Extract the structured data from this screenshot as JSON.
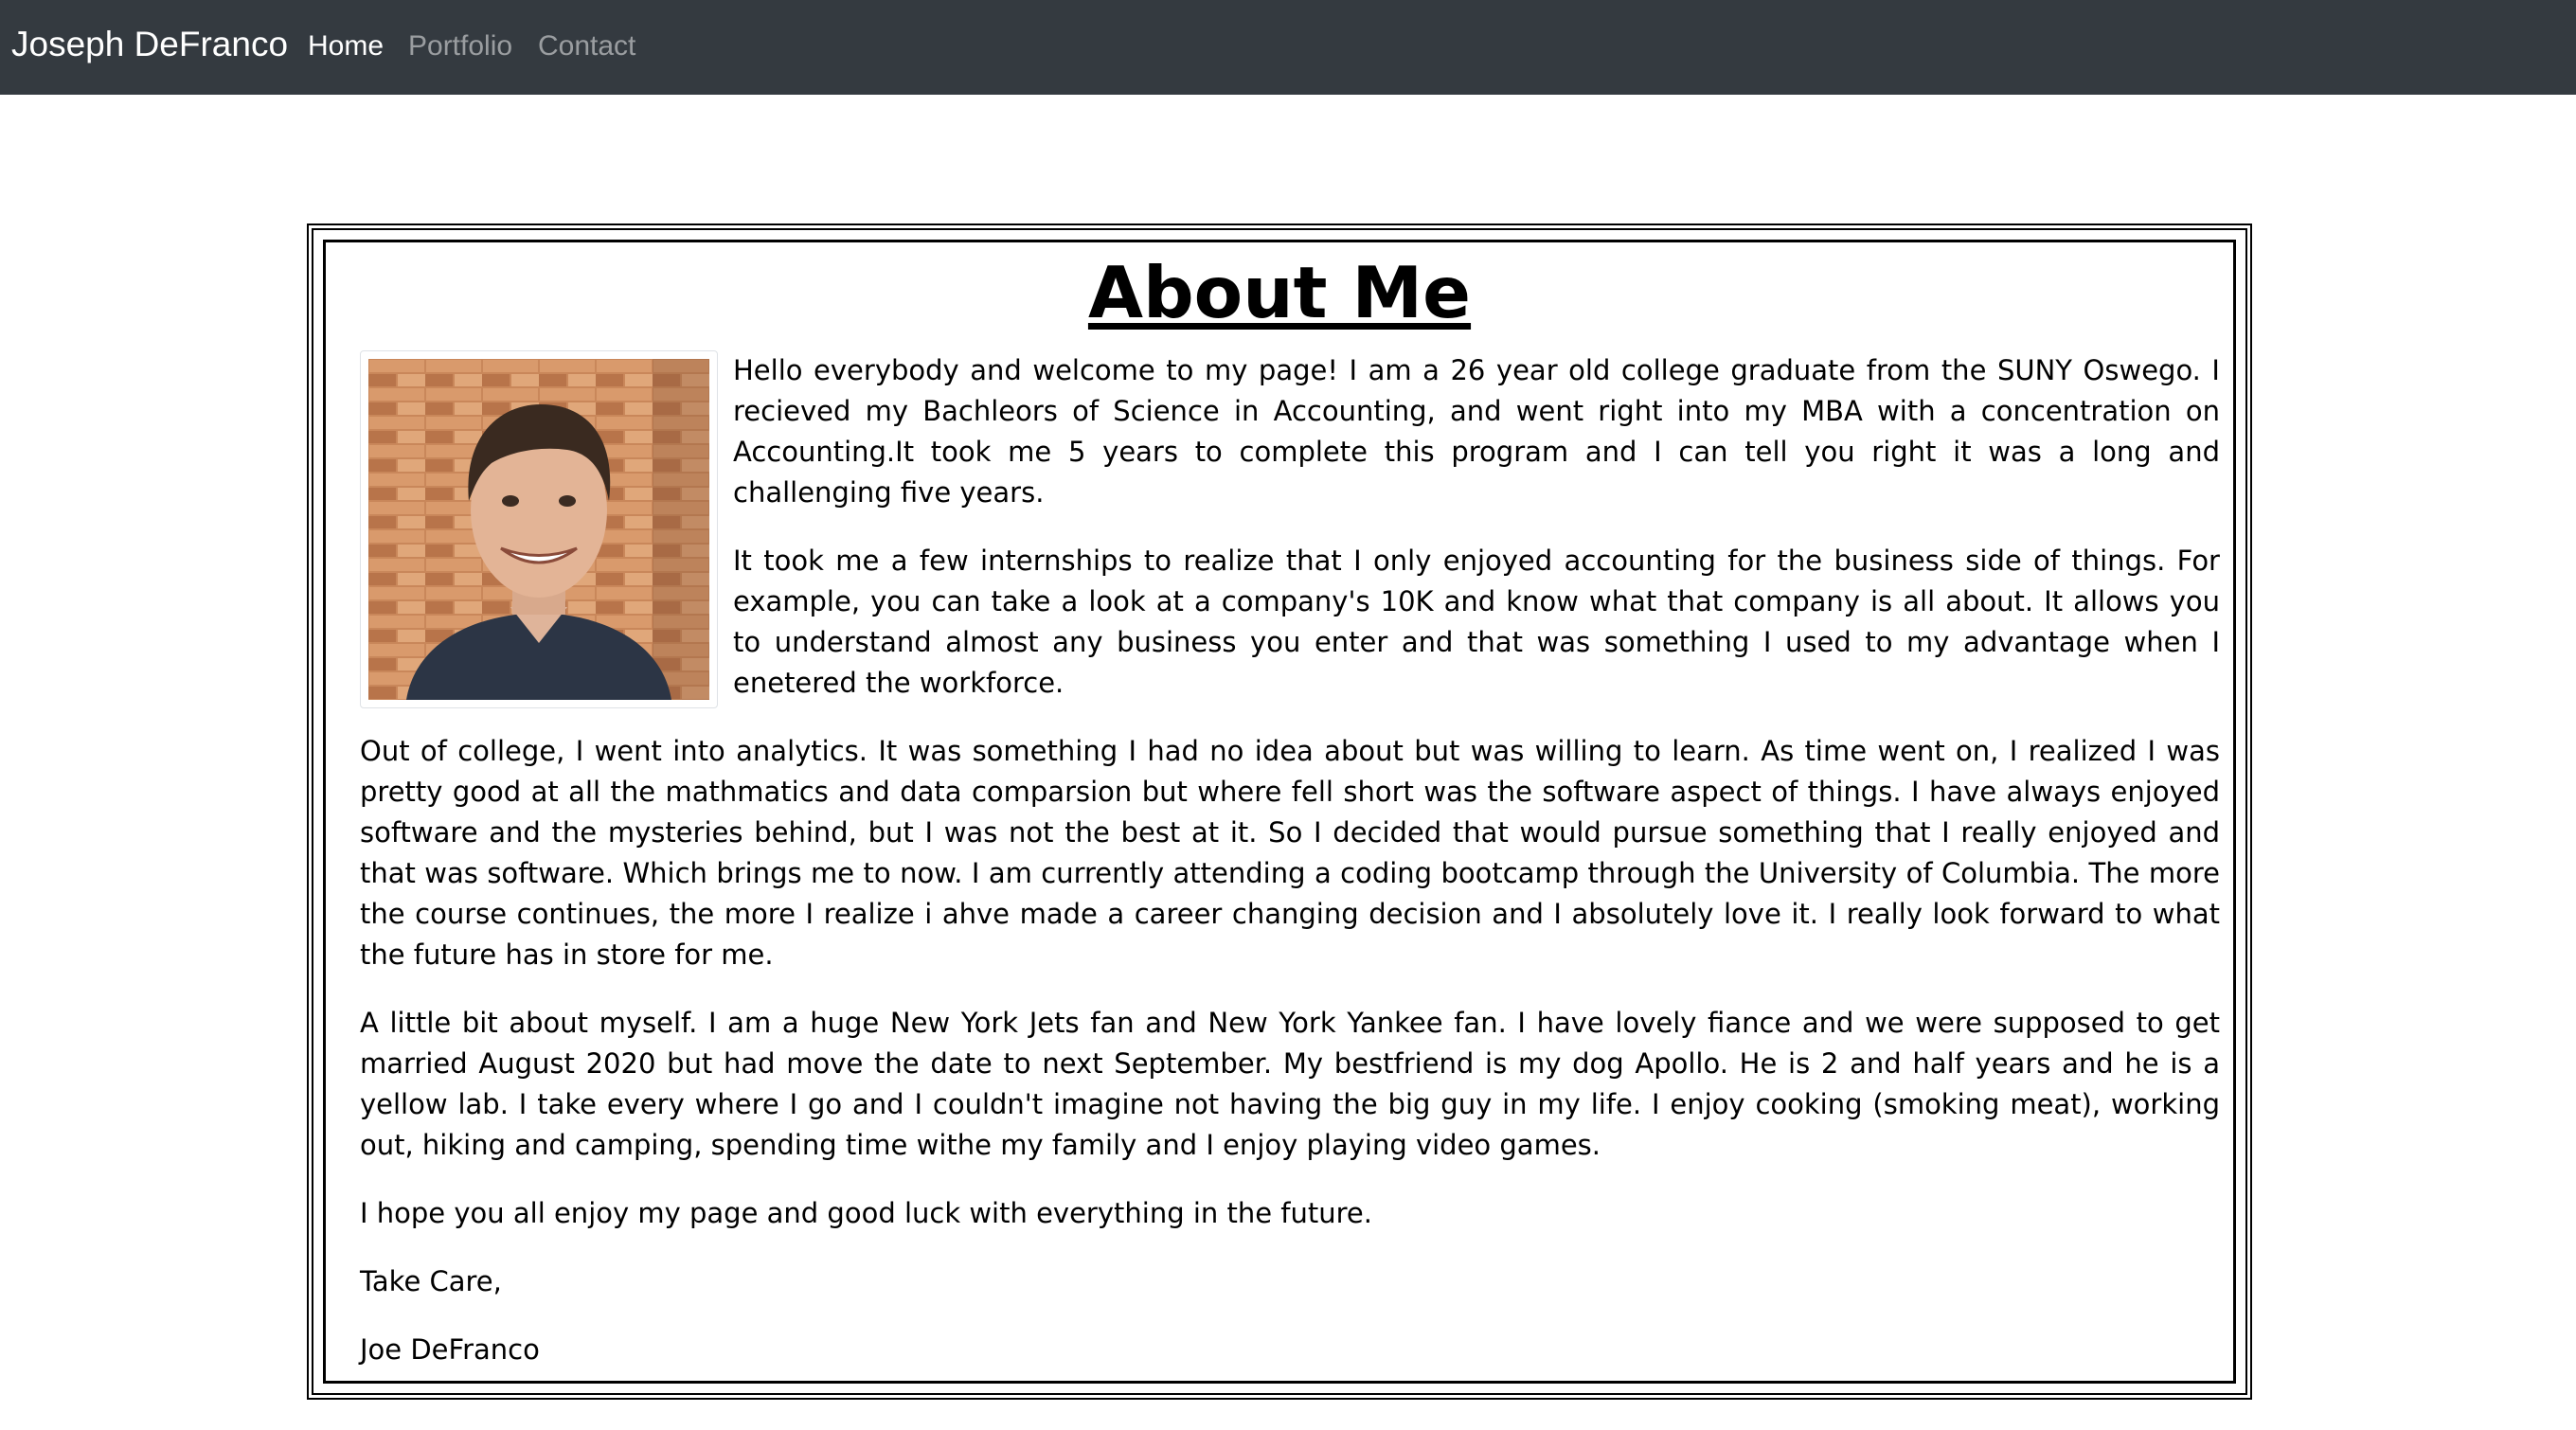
{
  "navbar": {
    "brand": "Joseph DeFranco",
    "links": [
      {
        "label": "Home",
        "active": true
      },
      {
        "label": "Portfolio",
        "active": false
      },
      {
        "label": "Contact",
        "active": false
      }
    ]
  },
  "about": {
    "title": "About Me",
    "paragraphs": [
      "Hello everybody and welcome to my page! I am a 26 year old college graduate from the SUNY Oswego. I recieved my Bachleors of Science in Accounting, and went right into my MBA with a concentration on Accounting.It took me 5 years to complete this program and I can tell you right it was a long and challenging five years.",
      "It took me a few internships to realize that I only enjoyed accounting for the business side of things. For example, you can take a look at a company's 10K and know what that company is all about. It allows you to understand almost any business you enter and that was something I used to my advantage when I enetered the workforce.",
      "Out of college, I went into analytics. It was something I had no idea about but was willing to learn. As time went on, I realized I was pretty good at all the mathmatics and data comparsion but where fell short was the software aspect of things. I have always enjoyed software and the mysteries behind, but I was not the best at it. So I decided that would pursue something that I really enjoyed and that was software. Which brings me to now. I am currently attending a coding bootcamp through the University of Columbia. The more the course continues, the more I realize i ahve made a career changing decision and I absolutely love it. I really look forward to what the future has in store for me.",
      "A little bit about myself. I am a huge New York Jets fan and New York Yankee fan. I have lovely fiance and we were supposed to get married August 2020 but had move the date to next September. My bestfriend is my dog Apollo. He is 2 and half years and he is a yellow lab. I take every where I go and I couldn't imagine not having the big guy in my life. I enjoy cooking (smoking meat), working out, hiking and camping, spending time withe my family and I enjoy playing video games.",
      "I hope you all enjoy my page and good luck with everything in the future.",
      "Take Care,",
      "Joe DeFranco"
    ]
  },
  "colors": {
    "navbar_bg": "#343a40",
    "nav_active": "#ffffff",
    "nav_inactive": "#9a9da0"
  }
}
